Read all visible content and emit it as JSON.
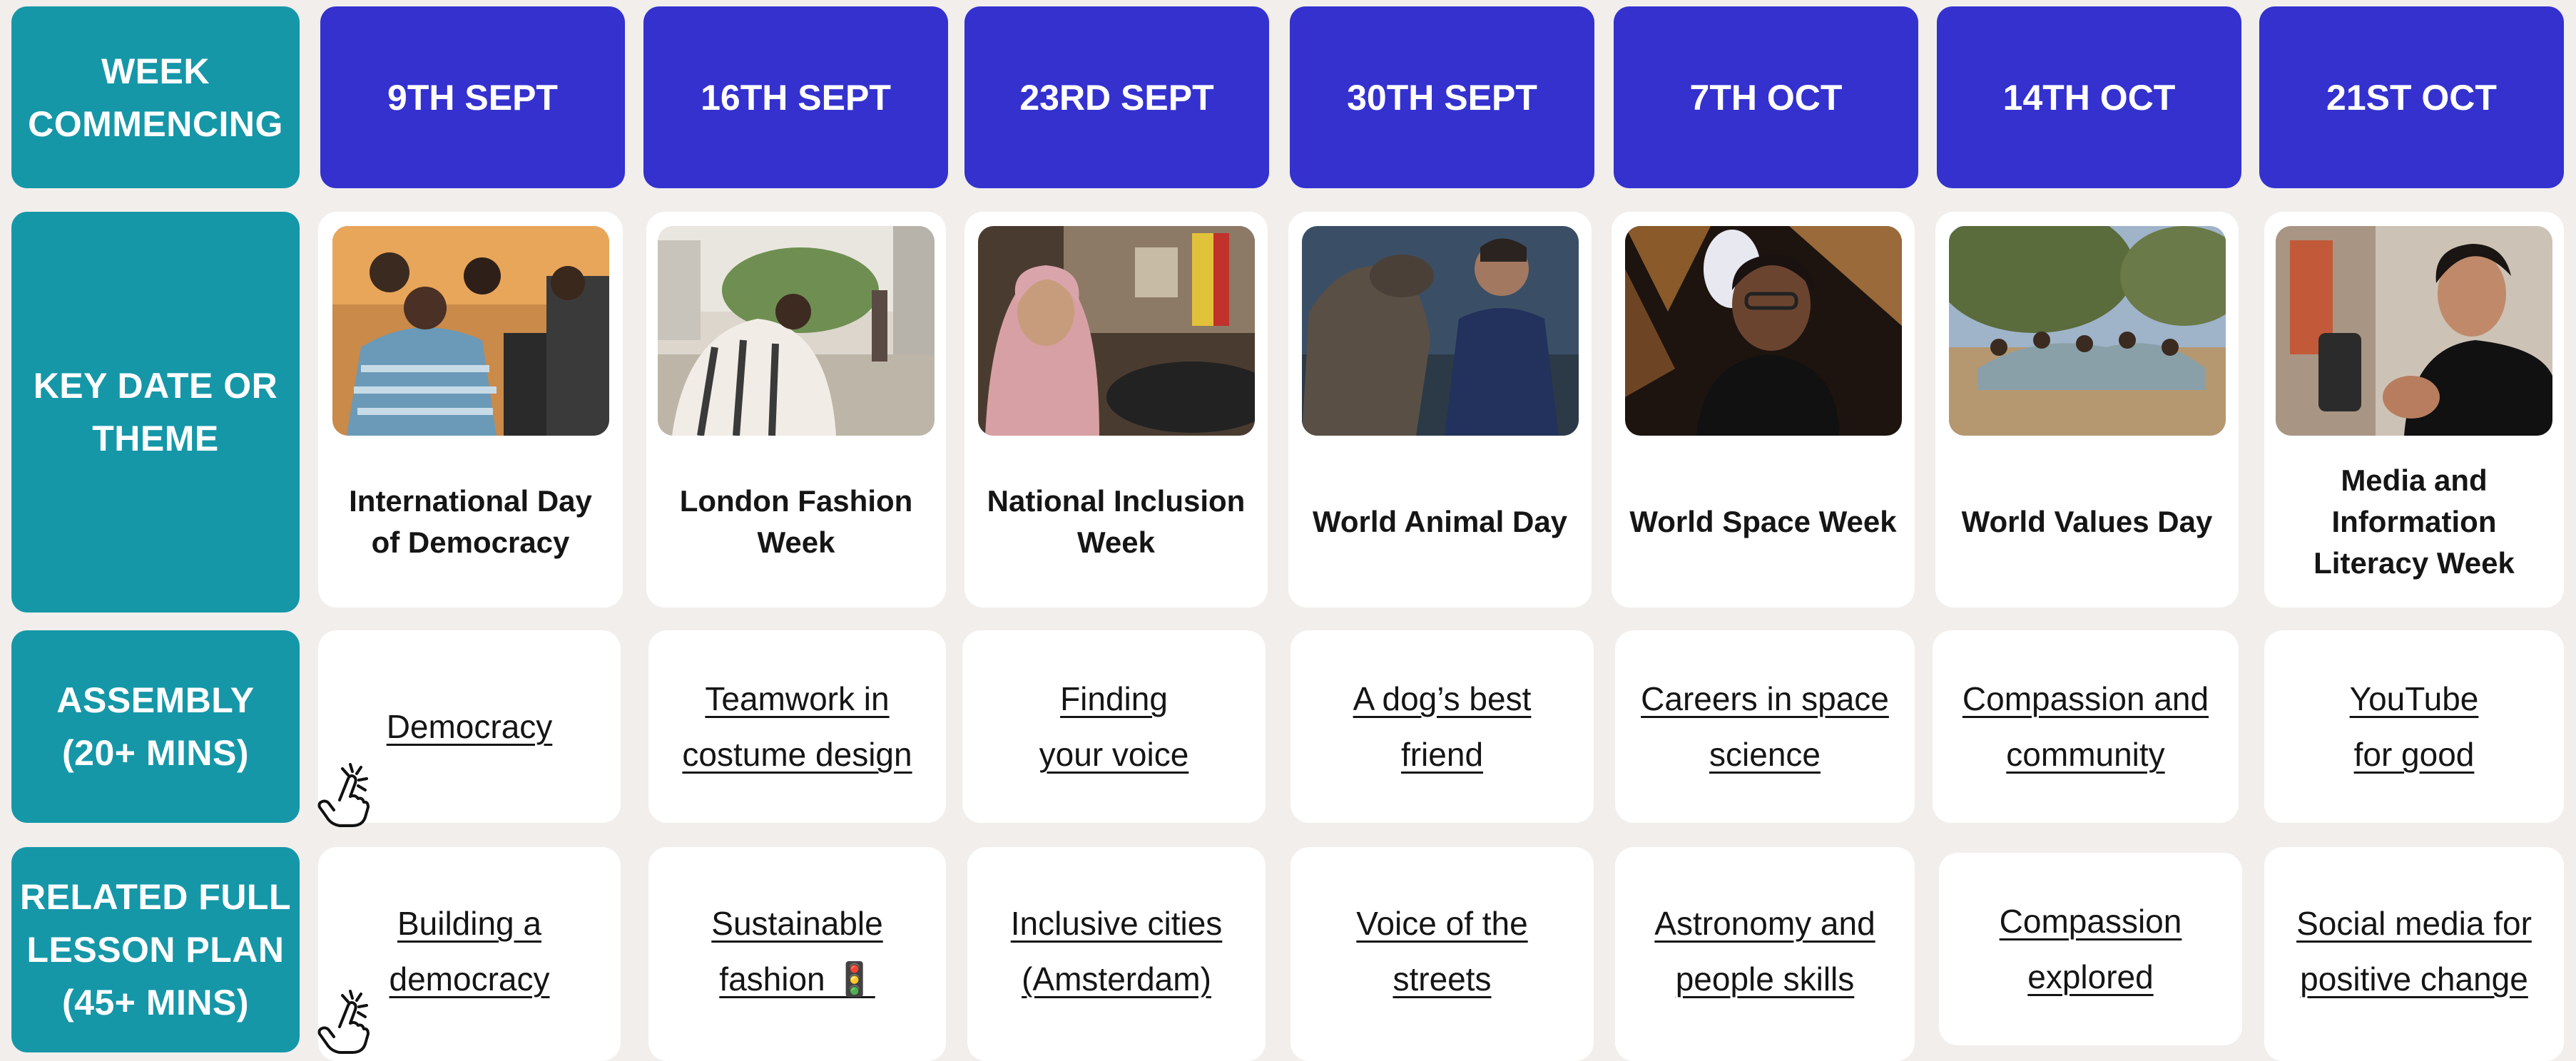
{
  "row_labels": {
    "week": "WEEK\nCOMMENCING",
    "theme": "KEY DATE OR\nTHEME",
    "assembly": "ASSEMBLY\n(20+ MINS)",
    "lesson": "RELATED FULL\nLESSON PLAN\n(45+ MINS)"
  },
  "weeks": [
    "9TH SEPT",
    "16TH SEPT",
    "23RD SEPT",
    "30TH SEPT",
    "7TH OCT",
    "14TH OCT",
    "21ST OCT"
  ],
  "themes": [
    "International Day\nof Democracy",
    "London Fashion\nWeek",
    "National Inclusion\nWeek",
    "World Animal Day",
    "World Space Week",
    "World Values Day",
    "Media and\nInformation\nLiteracy Week"
  ],
  "assemblies": [
    "Democracy",
    "Teamwork in\ncostume design",
    "Finding\nyour voice",
    "A dog’s best\nfriend",
    "Careers in space\nscience",
    "Compassion and\ncommunity",
    "YouTube\nfor good"
  ],
  "lessons": [
    "Building a\ndemocracy",
    "Sustainable\nfashion 🚦",
    "Inclusive cities\n(Amsterdam)",
    "Voice of the\nstreets",
    "Astronomy and\npeople skills",
    "Compassion\nexplored",
    "Social media for\npositive change"
  ],
  "icons": {
    "photo": "photo-thumbnail",
    "pointer": "hand-pointer-icon"
  },
  "colors": {
    "teal": "#1597a8",
    "blue": "#3431cf",
    "background": "#f1eeec",
    "card": "#ffffff"
  }
}
